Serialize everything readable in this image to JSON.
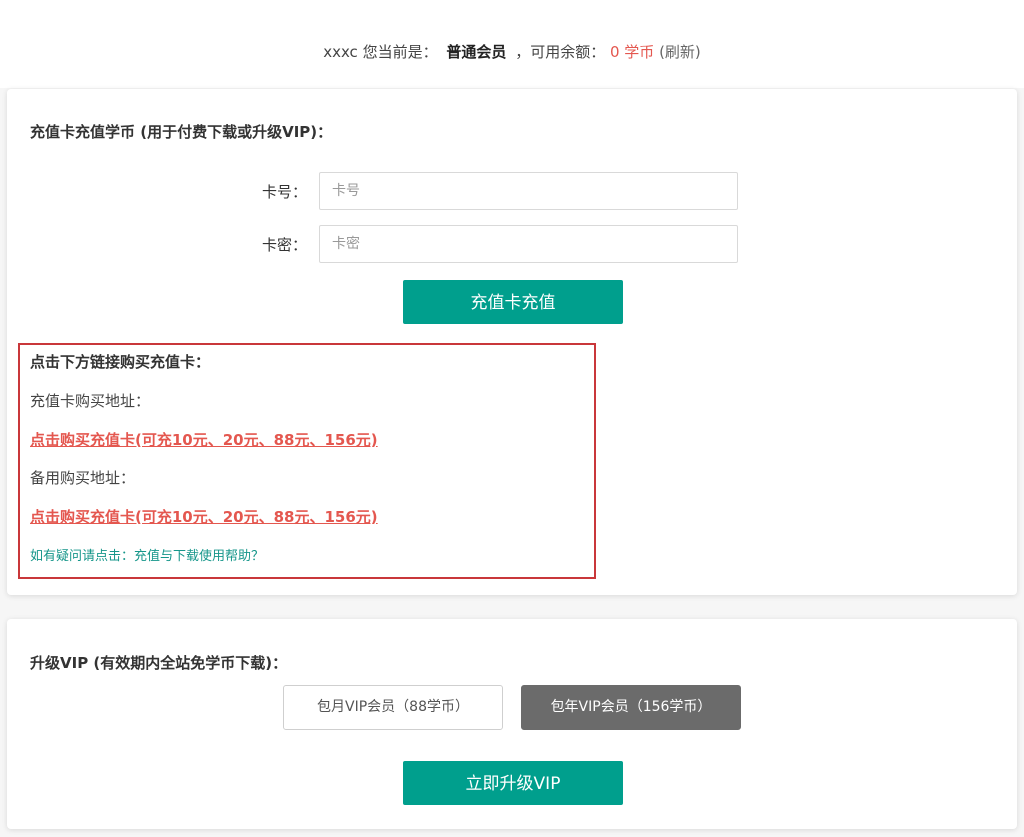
{
  "header": {
    "username": "xxxc",
    "status_prefix": "您当前是：",
    "member_level": "普通会员",
    "balance_prefix": "，可用余额：",
    "balance_amount": "0 学币",
    "refresh_label": "(刷新)"
  },
  "recharge": {
    "title": "充值卡充值学币 (用于付费下载或升级VIP)：",
    "card_label": "卡号：",
    "card_placeholder": "卡号",
    "card_value": "",
    "pwd_label": "卡密：",
    "pwd_placeholder": "卡密",
    "pwd_value": "",
    "submit_label": "充值卡充值"
  },
  "buy": {
    "title": "点击下方链接购买充值卡：",
    "primary_label": "充值卡购买地址：",
    "primary_link": "点击购买充值卡(可充10元、20元、88元、156元)",
    "backup_label": "备用购买地址：",
    "backup_link": "点击购买充值卡(可充10元、20元、88元、156元)",
    "help_link": "如有疑问请点击：充值与下载使用帮助？"
  },
  "vip": {
    "title": "升级VIP (有效期内全站免学币下载)：",
    "options": [
      {
        "label": "包月VIP会员（88学币）",
        "selected": false
      },
      {
        "label": "包年VIP会员（156学币）",
        "selected": true
      }
    ],
    "upgrade_label": "立即升级VIP"
  },
  "colors": {
    "accent": "#009f8d",
    "balance": "#e4574f",
    "link_red": "#e4574f",
    "help_teal": "#16968a",
    "box_border": "#c9373a",
    "selected_option": "#6b6b6b"
  }
}
